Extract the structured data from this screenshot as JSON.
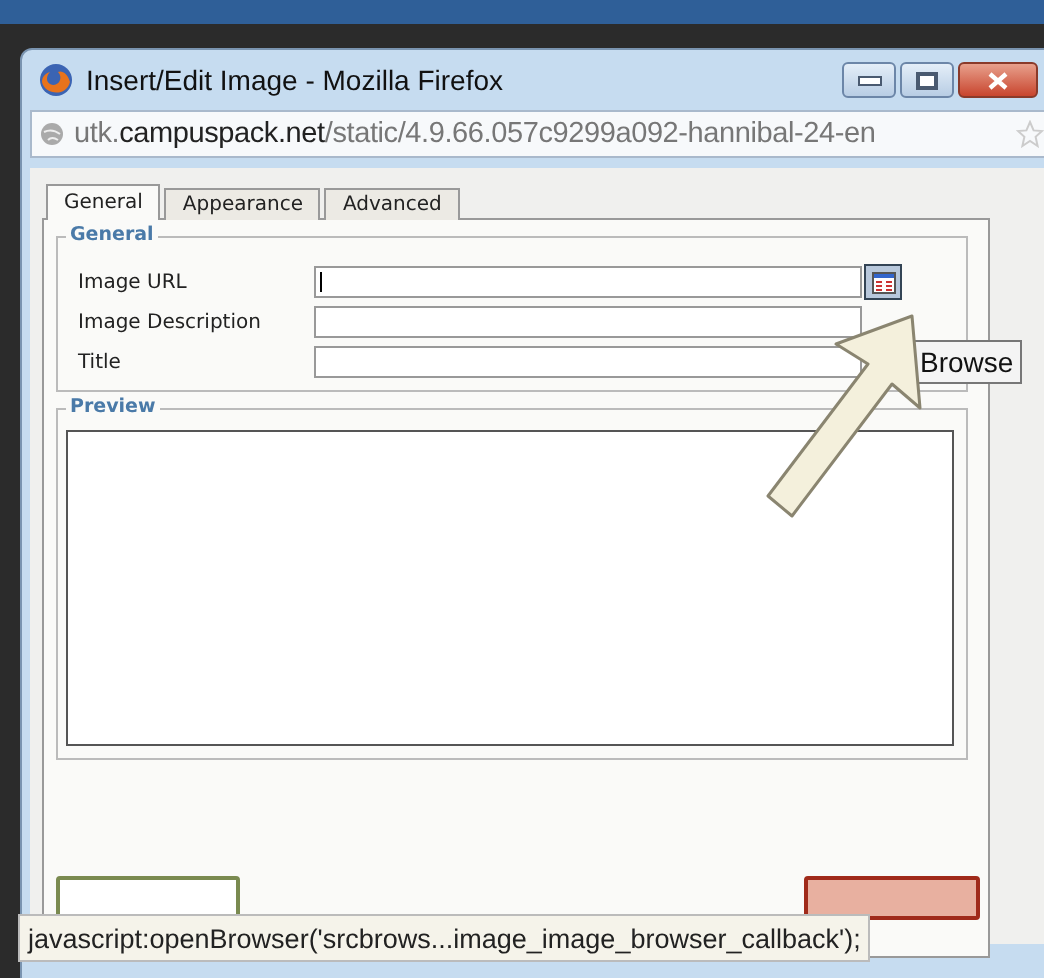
{
  "window": {
    "title": "Insert/Edit Image - Mozilla Firefox"
  },
  "address_bar": {
    "url": "utk.**campuspack.net**/static/4.9.66.057c9299a092-hannibal-24-en"
  },
  "tabs": [
    {
      "label": "General",
      "selected": true
    },
    {
      "label": "Appearance",
      "selected": false
    },
    {
      "label": "Advanced",
      "selected": false
    }
  ],
  "general_section": {
    "title": "General",
    "fields": [
      {
        "label": "Image URL",
        "browse": true
      },
      {
        "label": "Image Description",
        "browse": false
      },
      {
        "label": "Title",
        "browse": false
      }
    ]
  },
  "tooltip": "Browse",
  "preview_section": {
    "title": "Preview"
  },
  "status_bar": "javascript:openBrowser('srcbrows...image_image_browser_callback');"
}
